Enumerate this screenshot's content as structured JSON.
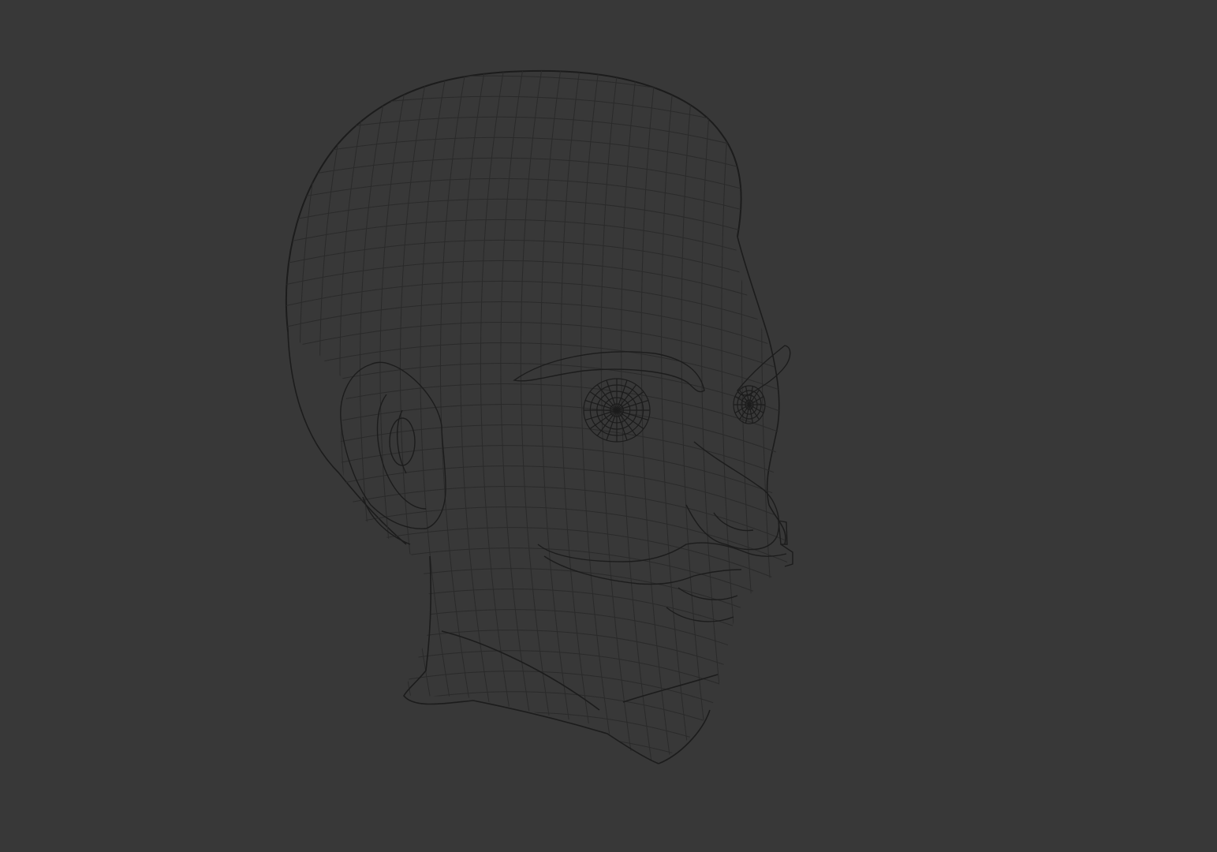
{
  "viewport": {
    "background_color": "#383838",
    "wire_color": "#1c1c1c",
    "wire_color_light": "#2a2a2a",
    "display_mode": "wireframe",
    "object": "head-mesh"
  }
}
